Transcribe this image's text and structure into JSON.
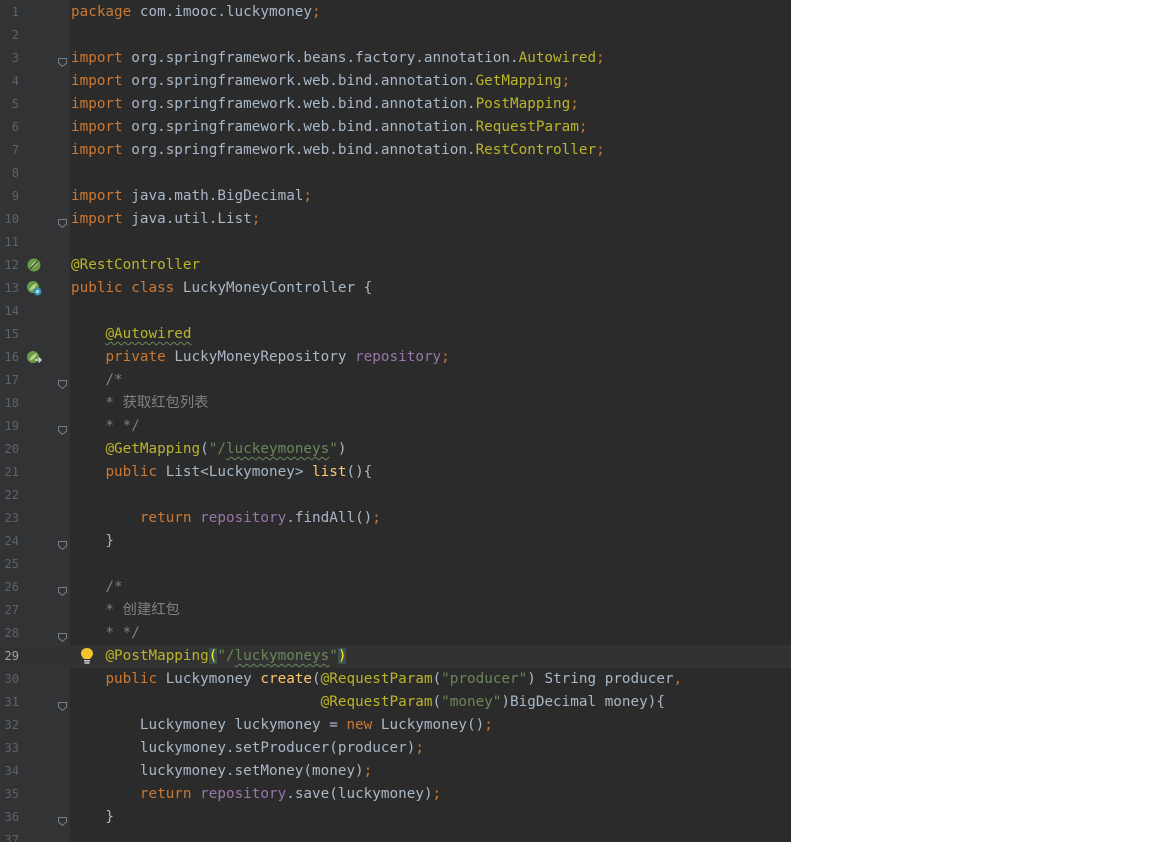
{
  "window": {
    "title": "",
    "current_line": 29
  },
  "theme": {
    "editor_background": "#2b2b2b",
    "gutter_background": "#313335",
    "keyword": "#cc7832",
    "annotation": "#bbb529",
    "string": "#6a8759",
    "field": "#9876aa",
    "method_declaration": "#ffc66d",
    "comment": "#808080",
    "plain": "#a9b7c6"
  },
  "icons": {
    "spring_bean_line_12": "spring-bean-icon",
    "spring_bean_line_13": "spring-bean-class-icon",
    "autowired_line_16": "autowired-navigate-icon",
    "intention_line_29": "lightbulb-icon",
    "fold_marker": "fold-marker-icon"
  },
  "lines": [
    {
      "n": 1,
      "tokens": [
        {
          "t": "package ",
          "c": "kw"
        },
        {
          "t": "com.imooc.luckymoney",
          "c": "pl"
        },
        {
          "t": ";",
          "c": "kw"
        }
      ]
    },
    {
      "n": 2,
      "tokens": []
    },
    {
      "n": 3,
      "fold": true,
      "tokens": [
        {
          "t": "import ",
          "c": "kw"
        },
        {
          "t": "org.springframework.beans.factory.annotation.",
          "c": "pl"
        },
        {
          "t": "Autowired",
          "c": "an"
        },
        {
          "t": ";",
          "c": "kw"
        }
      ]
    },
    {
      "n": 4,
      "tokens": [
        {
          "t": "import ",
          "c": "kw"
        },
        {
          "t": "org.springframework.web.bind.annotation.",
          "c": "pl"
        },
        {
          "t": "GetMapping",
          "c": "an"
        },
        {
          "t": ";",
          "c": "kw"
        }
      ]
    },
    {
      "n": 5,
      "tokens": [
        {
          "t": "import ",
          "c": "kw"
        },
        {
          "t": "org.springframework.web.bind.annotation.",
          "c": "pl"
        },
        {
          "t": "PostMapping",
          "c": "an"
        },
        {
          "t": ";",
          "c": "kw"
        }
      ]
    },
    {
      "n": 6,
      "tokens": [
        {
          "t": "import ",
          "c": "kw"
        },
        {
          "t": "org.springframework.web.bind.annotation.",
          "c": "pl"
        },
        {
          "t": "RequestParam",
          "c": "an"
        },
        {
          "t": ";",
          "c": "kw"
        }
      ]
    },
    {
      "n": 7,
      "tokens": [
        {
          "t": "import ",
          "c": "kw"
        },
        {
          "t": "org.springframework.web.bind.annotation.",
          "c": "pl"
        },
        {
          "t": "RestController",
          "c": "an"
        },
        {
          "t": ";",
          "c": "kw"
        }
      ]
    },
    {
      "n": 8,
      "tokens": []
    },
    {
      "n": 9,
      "tokens": [
        {
          "t": "import ",
          "c": "kw"
        },
        {
          "t": "java.math.BigDecimal",
          "c": "pl"
        },
        {
          "t": ";",
          "c": "kw"
        }
      ]
    },
    {
      "n": 10,
      "fold": true,
      "tokens": [
        {
          "t": "import ",
          "c": "kw"
        },
        {
          "t": "java.util.List",
          "c": "pl"
        },
        {
          "t": ";",
          "c": "kw"
        }
      ]
    },
    {
      "n": 11,
      "tokens": []
    },
    {
      "n": 12,
      "icon": "spring_bean_line_12",
      "tokens": [
        {
          "t": "@RestController",
          "c": "an"
        }
      ]
    },
    {
      "n": 13,
      "icon": "spring_bean_line_13",
      "tokens": [
        {
          "t": "public class ",
          "c": "kw"
        },
        {
          "t": "LuckyMoneyController {",
          "c": "pl"
        }
      ]
    },
    {
      "n": 14,
      "tokens": []
    },
    {
      "n": 15,
      "tokens": [
        {
          "t": "    ",
          "c": "pl"
        },
        {
          "t": "@Autowired",
          "c": "an",
          "wavy": true
        }
      ]
    },
    {
      "n": 16,
      "icon": "autowired_line_16",
      "tokens": [
        {
          "t": "    ",
          "c": "pl"
        },
        {
          "t": "private ",
          "c": "kw"
        },
        {
          "t": "LuckyMoneyRepository ",
          "c": "pl"
        },
        {
          "t": "repository",
          "c": "fld"
        },
        {
          "t": ";",
          "c": "kw"
        }
      ]
    },
    {
      "n": 17,
      "fold": true,
      "tokens": [
        {
          "t": "    /*",
          "c": "cm"
        }
      ]
    },
    {
      "n": 18,
      "tokens": [
        {
          "t": "    * 获取红包列表",
          "c": "cm"
        }
      ]
    },
    {
      "n": 19,
      "fold": true,
      "tokens": [
        {
          "t": "    * */",
          "c": "cm"
        }
      ]
    },
    {
      "n": 20,
      "tokens": [
        {
          "t": "    ",
          "c": "pl"
        },
        {
          "t": "@GetMapping",
          "c": "an"
        },
        {
          "t": "(",
          "c": "pl"
        },
        {
          "t": "\"/",
          "c": "str"
        },
        {
          "t": "luckeymoneys",
          "c": "str",
          "wavy": true
        },
        {
          "t": "\"",
          "c": "str"
        },
        {
          "t": ")",
          "c": "pl"
        }
      ]
    },
    {
      "n": 21,
      "tokens": [
        {
          "t": "    ",
          "c": "pl"
        },
        {
          "t": "public ",
          "c": "kw"
        },
        {
          "t": "List<Luckymoney> ",
          "c": "pl"
        },
        {
          "t": "list",
          "c": "fn"
        },
        {
          "t": "(){",
          "c": "pl"
        }
      ]
    },
    {
      "n": 22,
      "tokens": []
    },
    {
      "n": 23,
      "tokens": [
        {
          "t": "        ",
          "c": "pl"
        },
        {
          "t": "return ",
          "c": "kw"
        },
        {
          "t": "repository",
          "c": "fld"
        },
        {
          "t": ".findAll()",
          "c": "pl"
        },
        {
          "t": ";",
          "c": "kw"
        }
      ]
    },
    {
      "n": 24,
      "fold": true,
      "tokens": [
        {
          "t": "    }",
          "c": "pl"
        }
      ]
    },
    {
      "n": 25,
      "tokens": []
    },
    {
      "n": 26,
      "fold": true,
      "tokens": [
        {
          "t": "    /*",
          "c": "cm"
        }
      ]
    },
    {
      "n": 27,
      "tokens": [
        {
          "t": "    * 创建红包",
          "c": "cm"
        }
      ]
    },
    {
      "n": 28,
      "fold": true,
      "tokens": [
        {
          "t": "    * */",
          "c": "cm"
        }
      ]
    },
    {
      "n": 29,
      "icon": "intention_line_29",
      "caret": true,
      "tokens": [
        {
          "t": "    ",
          "c": "pl"
        },
        {
          "t": "@PostMapping",
          "c": "an"
        },
        {
          "t": "(",
          "c": "brh"
        },
        {
          "t": "\"/",
          "c": "str"
        },
        {
          "t": "luckymoneys",
          "c": "str",
          "wavy": true
        },
        {
          "t": "\"",
          "c": "str"
        },
        {
          "t": ")",
          "c": "brh"
        }
      ]
    },
    {
      "n": 30,
      "tokens": [
        {
          "t": "    ",
          "c": "pl"
        },
        {
          "t": "public ",
          "c": "kw"
        },
        {
          "t": "Luckymoney ",
          "c": "pl"
        },
        {
          "t": "create",
          "c": "fn"
        },
        {
          "t": "(",
          "c": "pl"
        },
        {
          "t": "@RequestParam",
          "c": "an"
        },
        {
          "t": "(",
          "c": "pl"
        },
        {
          "t": "\"producer\"",
          "c": "str"
        },
        {
          "t": ") String producer",
          "c": "pl"
        },
        {
          "t": ",",
          "c": "kw"
        }
      ]
    },
    {
      "n": 31,
      "fold": true,
      "tokens": [
        {
          "t": "                             ",
          "c": "pl"
        },
        {
          "t": "@RequestParam",
          "c": "an"
        },
        {
          "t": "(",
          "c": "pl"
        },
        {
          "t": "\"money\"",
          "c": "str"
        },
        {
          "t": ")BigDecimal money){",
          "c": "pl"
        }
      ]
    },
    {
      "n": 32,
      "tokens": [
        {
          "t": "        Luckymoney luckymoney = ",
          "c": "pl"
        },
        {
          "t": "new ",
          "c": "kw"
        },
        {
          "t": "Luckymoney()",
          "c": "pl"
        },
        {
          "t": ";",
          "c": "kw"
        }
      ]
    },
    {
      "n": 33,
      "tokens": [
        {
          "t": "        luckymoney.setProducer(producer)",
          "c": "pl"
        },
        {
          "t": ";",
          "c": "kw"
        }
      ]
    },
    {
      "n": 34,
      "tokens": [
        {
          "t": "        luckymoney.setMoney(money)",
          "c": "pl"
        },
        {
          "t": ";",
          "c": "kw"
        }
      ]
    },
    {
      "n": 35,
      "tokens": [
        {
          "t": "        ",
          "c": "pl"
        },
        {
          "t": "return ",
          "c": "kw"
        },
        {
          "t": "repository",
          "c": "fld"
        },
        {
          "t": ".save(luckymoney)",
          "c": "pl"
        },
        {
          "t": ";",
          "c": "kw"
        }
      ]
    },
    {
      "n": 36,
      "fold": true,
      "tokens": [
        {
          "t": "    }",
          "c": "pl"
        }
      ]
    },
    {
      "n": 37,
      "tokens": []
    }
  ]
}
